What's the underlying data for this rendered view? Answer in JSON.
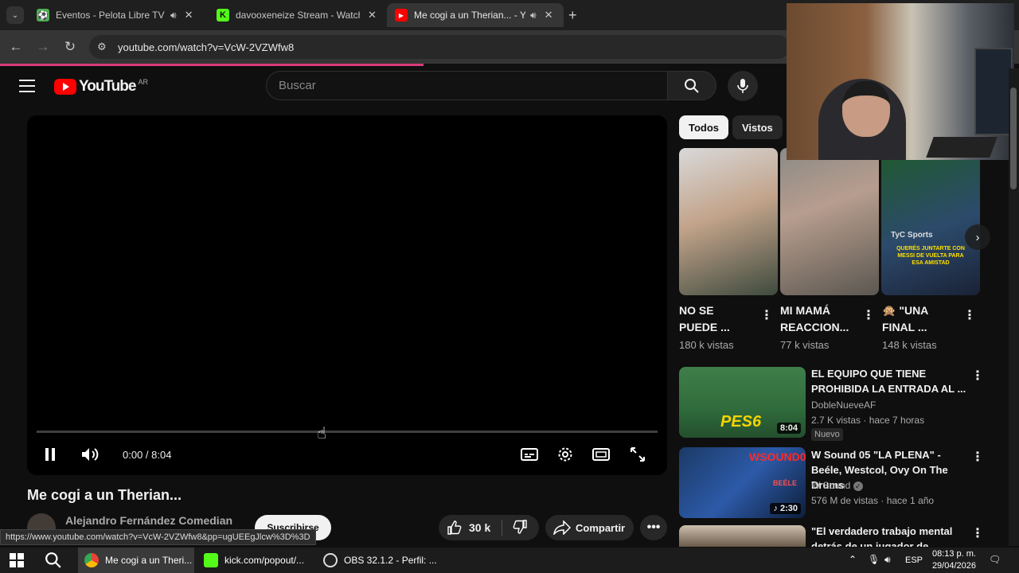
{
  "tabs": [
    {
      "title": "Eventos - Pelota Libre TV",
      "favicon_color": "#4caf50"
    },
    {
      "title": "davooxeneize Stream - Watch L",
      "favicon_color": "#53fc18"
    },
    {
      "title": "Me cogi a un Therian... - Yo",
      "favicon_color": "#ff0000"
    }
  ],
  "address": {
    "url": "youtube.com/watch?v=VcW-2VZWfw8"
  },
  "youtube": {
    "logo_text": "YouTube",
    "country_code": "AR",
    "search_placeholder": "Buscar"
  },
  "player": {
    "time": "0:00 / 8:04",
    "progress": 0
  },
  "video": {
    "title": "Me cogi a un Therian...",
    "channel": "Alejandro Fernández Comedian",
    "subscribe_label": "Suscribirse",
    "likes": "30 k",
    "share_label": "Compartir"
  },
  "status_url": "https://www.youtube.com/watch?v=VcW-2VZWfw8&pp=ugUEEgJlcw%3D%3D",
  "chips": [
    {
      "label": "Todos"
    },
    {
      "label": "Vistos"
    }
  ],
  "shorts": [
    {
      "title": "NO SE PUEDE ...",
      "views": "180 k vistas",
      "thumb_color": "#3e4a3e"
    },
    {
      "title": "MI MAMÁ REACCION...",
      "views": "77 k vistas",
      "thumb_color": "#5b5750"
    },
    {
      "title": "\"UNA FINAL ...",
      "views": "148 k vistas",
      "thumb_color": "#2c4a6b",
      "overlay_text": "QUERÉS JUNTARTE CON MESSI DE VUELTA PARA ESA AMISTAD",
      "brand": "TyC Sports"
    }
  ],
  "recommendations": [
    {
      "title": "EL EQUIPO QUE TIENE PROHIBIDA LA ENTRADA AL ...",
      "channel": "DobleNueveAF",
      "meta": "2.7 K vistas · hace 7 horas",
      "duration": "8:04",
      "badge": "Nuevo",
      "thumb_color": "#2f6b3b",
      "thumb_text": "PES6"
    },
    {
      "title": "W Sound 05 \"LA PLENA\" - Beéle, Westcol, Ovy On The Drums",
      "channel": "W Sound",
      "meta": "576 M de vistas · hace 1 año",
      "duration": "2:30",
      "thumb_color": "#1b3a66",
      "thumb_text": "WSOUND05",
      "thumb_subtext": "BEÉLE"
    },
    {
      "title": "\"El verdadero trabajo mental detrás de un jugador de",
      "thumb_color": "#6b5b4a"
    }
  ],
  "taskbar": {
    "items": [
      {
        "label": "Me cogi a un Theri..."
      },
      {
        "label": "kick.com/popout/..."
      },
      {
        "label": "OBS 32.1.2 - Perfil: ..."
      }
    ],
    "lang": "ESP",
    "time": "08:13 p. m.",
    "date": "29/04/2026"
  }
}
